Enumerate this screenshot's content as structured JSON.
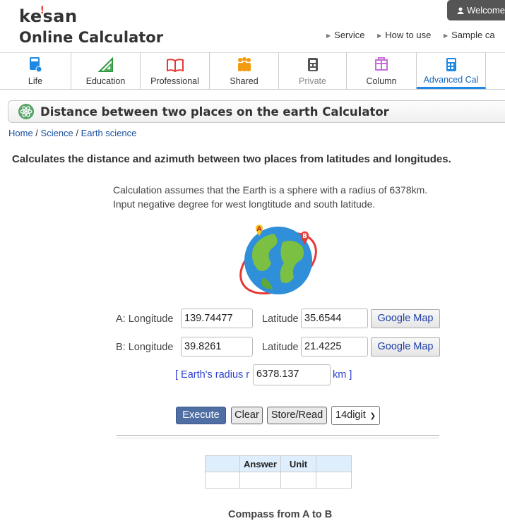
{
  "header": {
    "logo_line1_a": "ke",
    "logo_line1_b": "san",
    "logo_line2": "Online Calculator",
    "welcome": "Welcome",
    "nav": [
      "Service",
      "How to use",
      "Sample ca"
    ]
  },
  "tabs": [
    {
      "label": "Life",
      "icon": "calculator-icon"
    },
    {
      "label": "Education",
      "icon": "set-square-icon"
    },
    {
      "label": "Professional",
      "icon": "book-icon"
    },
    {
      "label": "Shared",
      "icon": "people-icon"
    },
    {
      "label": "Private",
      "icon": "private-icon"
    },
    {
      "label": "Column",
      "icon": "column-icon"
    },
    {
      "label": "Advanced Cal",
      "icon": "advanced-calculator-icon"
    }
  ],
  "page": {
    "title": "Distance between two places on the earth Calculator",
    "breadcrumb": [
      "Home",
      "Science",
      "Earth science"
    ],
    "description": "Calculates the distance and azimuth between two places from latitudes and longitudes.",
    "note1": "Calculation assumes that the Earth is a sphere with a radius of 6378km.",
    "note2": "Input negative degree for west longtitude and south latitude."
  },
  "form": {
    "a_longitude_label": "A: Longitude",
    "a_longitude": "139.74477",
    "a_latitude_label": "Latitude",
    "a_latitude": "35.6544",
    "b_longitude_label": "B: Longitude",
    "b_longitude": "39.8261",
    "b_latitude_label": "Latitude",
    "b_latitude": "21.4225",
    "google_map": "Google Map",
    "radius_label": "[ Earth's radius r",
    "radius": "6378.137",
    "radius_unit": "km ]"
  },
  "buttons": {
    "execute": "Execute",
    "clear": "Clear",
    "store": "Store/Read",
    "digits": "14digit"
  },
  "results": {
    "headers": [
      "",
      "Answer",
      "Unit",
      ""
    ],
    "compass_title": "Compass from A to B"
  },
  "colors": {
    "accent": "#1e88e5",
    "execute_bg": "#4e6ea4",
    "table_header": "#dfeefc"
  }
}
